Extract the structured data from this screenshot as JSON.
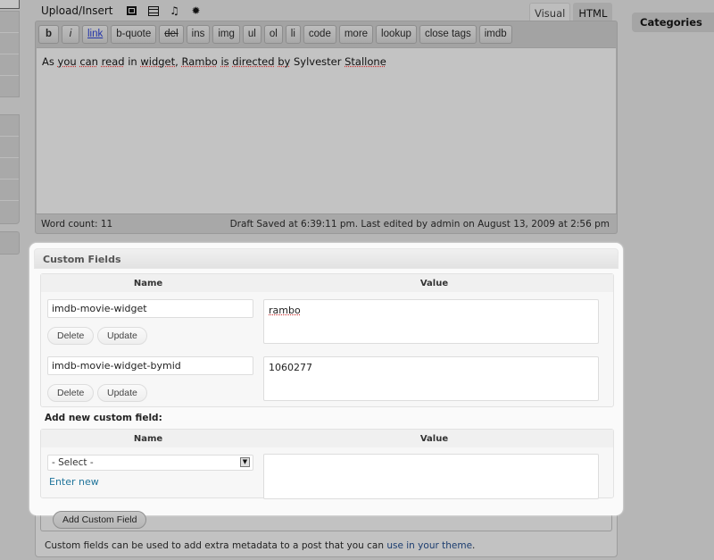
{
  "toolbar": {
    "upload_label": "Upload/Insert",
    "icons": [
      "add-image-icon",
      "add-video-icon",
      "add-audio-icon",
      "add-media-icon"
    ]
  },
  "editor_tabs": [
    "Visual",
    "HTML"
  ],
  "active_editor_tab": "HTML",
  "quicktags": [
    "b",
    "i",
    "link",
    "b-quote",
    "del",
    "ins",
    "img",
    "ul",
    "ol",
    "li",
    "code",
    "more",
    "lookup",
    "close tags",
    "imdb"
  ],
  "editor": {
    "content_words": [
      "As",
      "you",
      "can",
      "read",
      "in",
      "widget,",
      "Rambo",
      "is",
      "directed",
      "by",
      "Sylvester",
      "Stallone"
    ],
    "word_count": "Word count: 11",
    "draft_status": "Draft Saved at 6:39:11 pm. Last edited by admin on August 13, 2009 at 2:56 pm"
  },
  "sidebar": {
    "categories_title": "Categories"
  },
  "custom_fields": {
    "title": "Custom Fields",
    "col_name": "Name",
    "col_value": "Value",
    "fields": [
      {
        "key": "imdb-movie-widget",
        "value": "rambo"
      },
      {
        "key": "imdb-movie-widget-bymid",
        "value": "1060277"
      }
    ],
    "delete_label": "Delete",
    "update_label": "Update",
    "add_new_label": "Add new custom field:",
    "select_value": "- Select -",
    "enter_new_label": "Enter new",
    "new_value": "",
    "add_button_label": "Add Custom Field",
    "note_prefix": "Custom fields can be used to add extra metadata to a post that you can ",
    "note_link": "use in your theme",
    "note_suffix": "."
  }
}
